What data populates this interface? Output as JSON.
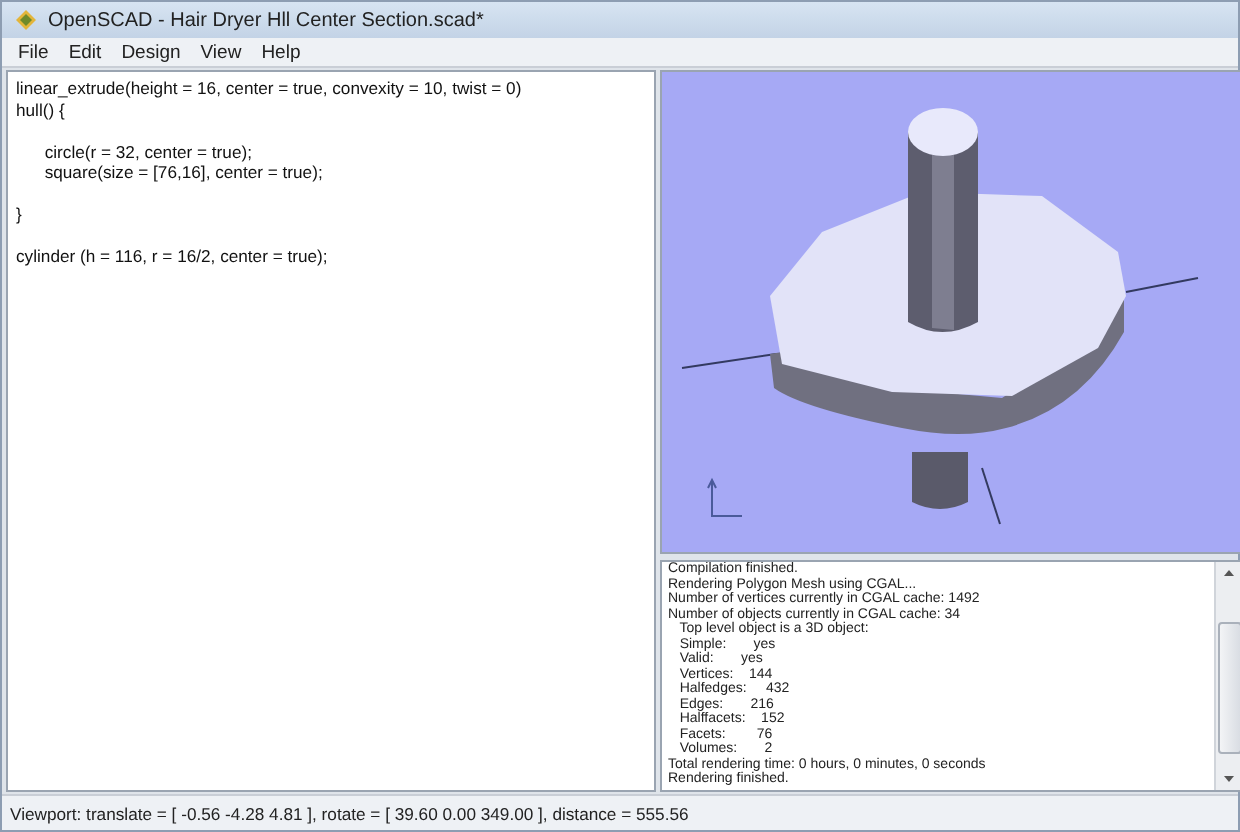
{
  "window": {
    "title": "OpenSCAD - Hair Dryer Hll Center Section.scad*"
  },
  "menu": [
    {
      "label": "File"
    },
    {
      "label": "Edit"
    },
    {
      "label": "Design"
    },
    {
      "label": "View"
    },
    {
      "label": "Help"
    }
  ],
  "editor": {
    "lines": [
      {
        "text": "linear_extrude(height = 16, center = true, convexity = 10, twist = 0)",
        "gap_before": false
      },
      {
        "text": "hull() {",
        "gap_before": false
      },
      {
        "text": "      circle(r = 32, center = true);",
        "gap_before": true
      },
      {
        "text": "      square(size = [76,16], center = true);",
        "gap_before": false
      },
      {
        "text": "}",
        "gap_before": true
      },
      {
        "text": "cylinder (h = 116, r = 16/2, center = true);",
        "gap_before": true
      }
    ]
  },
  "console": {
    "lines": [
      "Compilation finished.",
      "Rendering Polygon Mesh using CGAL...",
      "Number of vertices currently in CGAL cache: 1492",
      "Number of objects currently in CGAL cache: 34",
      "   Top level object is a 3D object:",
      "   Simple:       yes",
      "   Valid:       yes",
      "   Vertices:    144",
      "   Halfedges:     432",
      "   Edges:       216",
      "   Halffacets:    152",
      "   Facets:        76",
      "   Volumes:       2",
      "Total rendering time: 0 hours, 0 minutes, 0 seconds",
      "Rendering finished."
    ]
  },
  "status_bar": {
    "text": "Viewport: translate = [ -0.56 -4.28 4.81 ], rotate = [ 39.60 0.00 349.00 ], distance = 555.56"
  }
}
